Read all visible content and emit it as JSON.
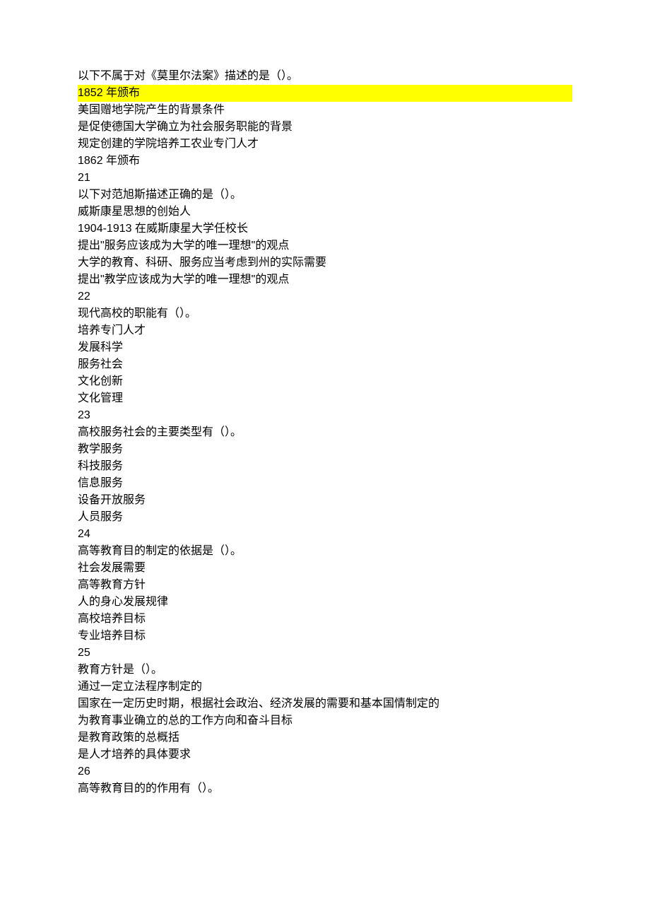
{
  "q20": {
    "stem": "以下不属于对《莫里尔法案》描述的是（）。",
    "opts": [
      "1852 年颁布",
      "美国赠地学院产生的背景条件",
      "是促使德国大学确立为社会服务职能的背景",
      "规定创建的学院培养工农业专门人才",
      "1862 年颁布"
    ]
  },
  "n21": "21",
  "q21": {
    "stem": "以下对范旭斯描述正确的是（）。",
    "opts": [
      "威斯康星思想的创始人",
      "1904-1913 在威斯康星大学任校长",
      "提出\"服务应该成为大学的唯一理想\"的观点",
      "大学的教育、科研、服务应当考虑到州的实际需要",
      "提出\"教学应该成为大学的唯一理想\"的观点"
    ]
  },
  "n22": "22",
  "q22": {
    "stem": "现代高校的职能有（）。",
    "opts": [
      "培养专门人才",
      "发展科学",
      "服务社会",
      "文化创新",
      "文化管理"
    ]
  },
  "n23": "23",
  "q23": {
    "stem": "高校服务社会的主要类型有（）。",
    "opts": [
      "教学服务",
      "科技服务",
      "信息服务",
      "设备开放服务",
      "人员服务"
    ]
  },
  "n24": "24",
  "q24": {
    "stem": "高等教育目的制定的依据是（）。",
    "opts": [
      "社会发展需要",
      "高等教育方针",
      "人的身心发展规律",
      "高校培养目标",
      "专业培养目标"
    ]
  },
  "n25": "25",
  "q25": {
    "stem": "教育方针是（）。",
    "opts": [
      "通过一定立法程序制定的",
      "国家在一定历史时期，根据社会政治、经济发展的需要和基本国情制定的",
      "为教育事业确立的总的工作方向和奋斗目标",
      "是教育政策的总概括",
      "是人才培养的具体要求"
    ]
  },
  "n26": "26",
  "q26": {
    "stem": "高等教育目的的作用有（）。"
  }
}
